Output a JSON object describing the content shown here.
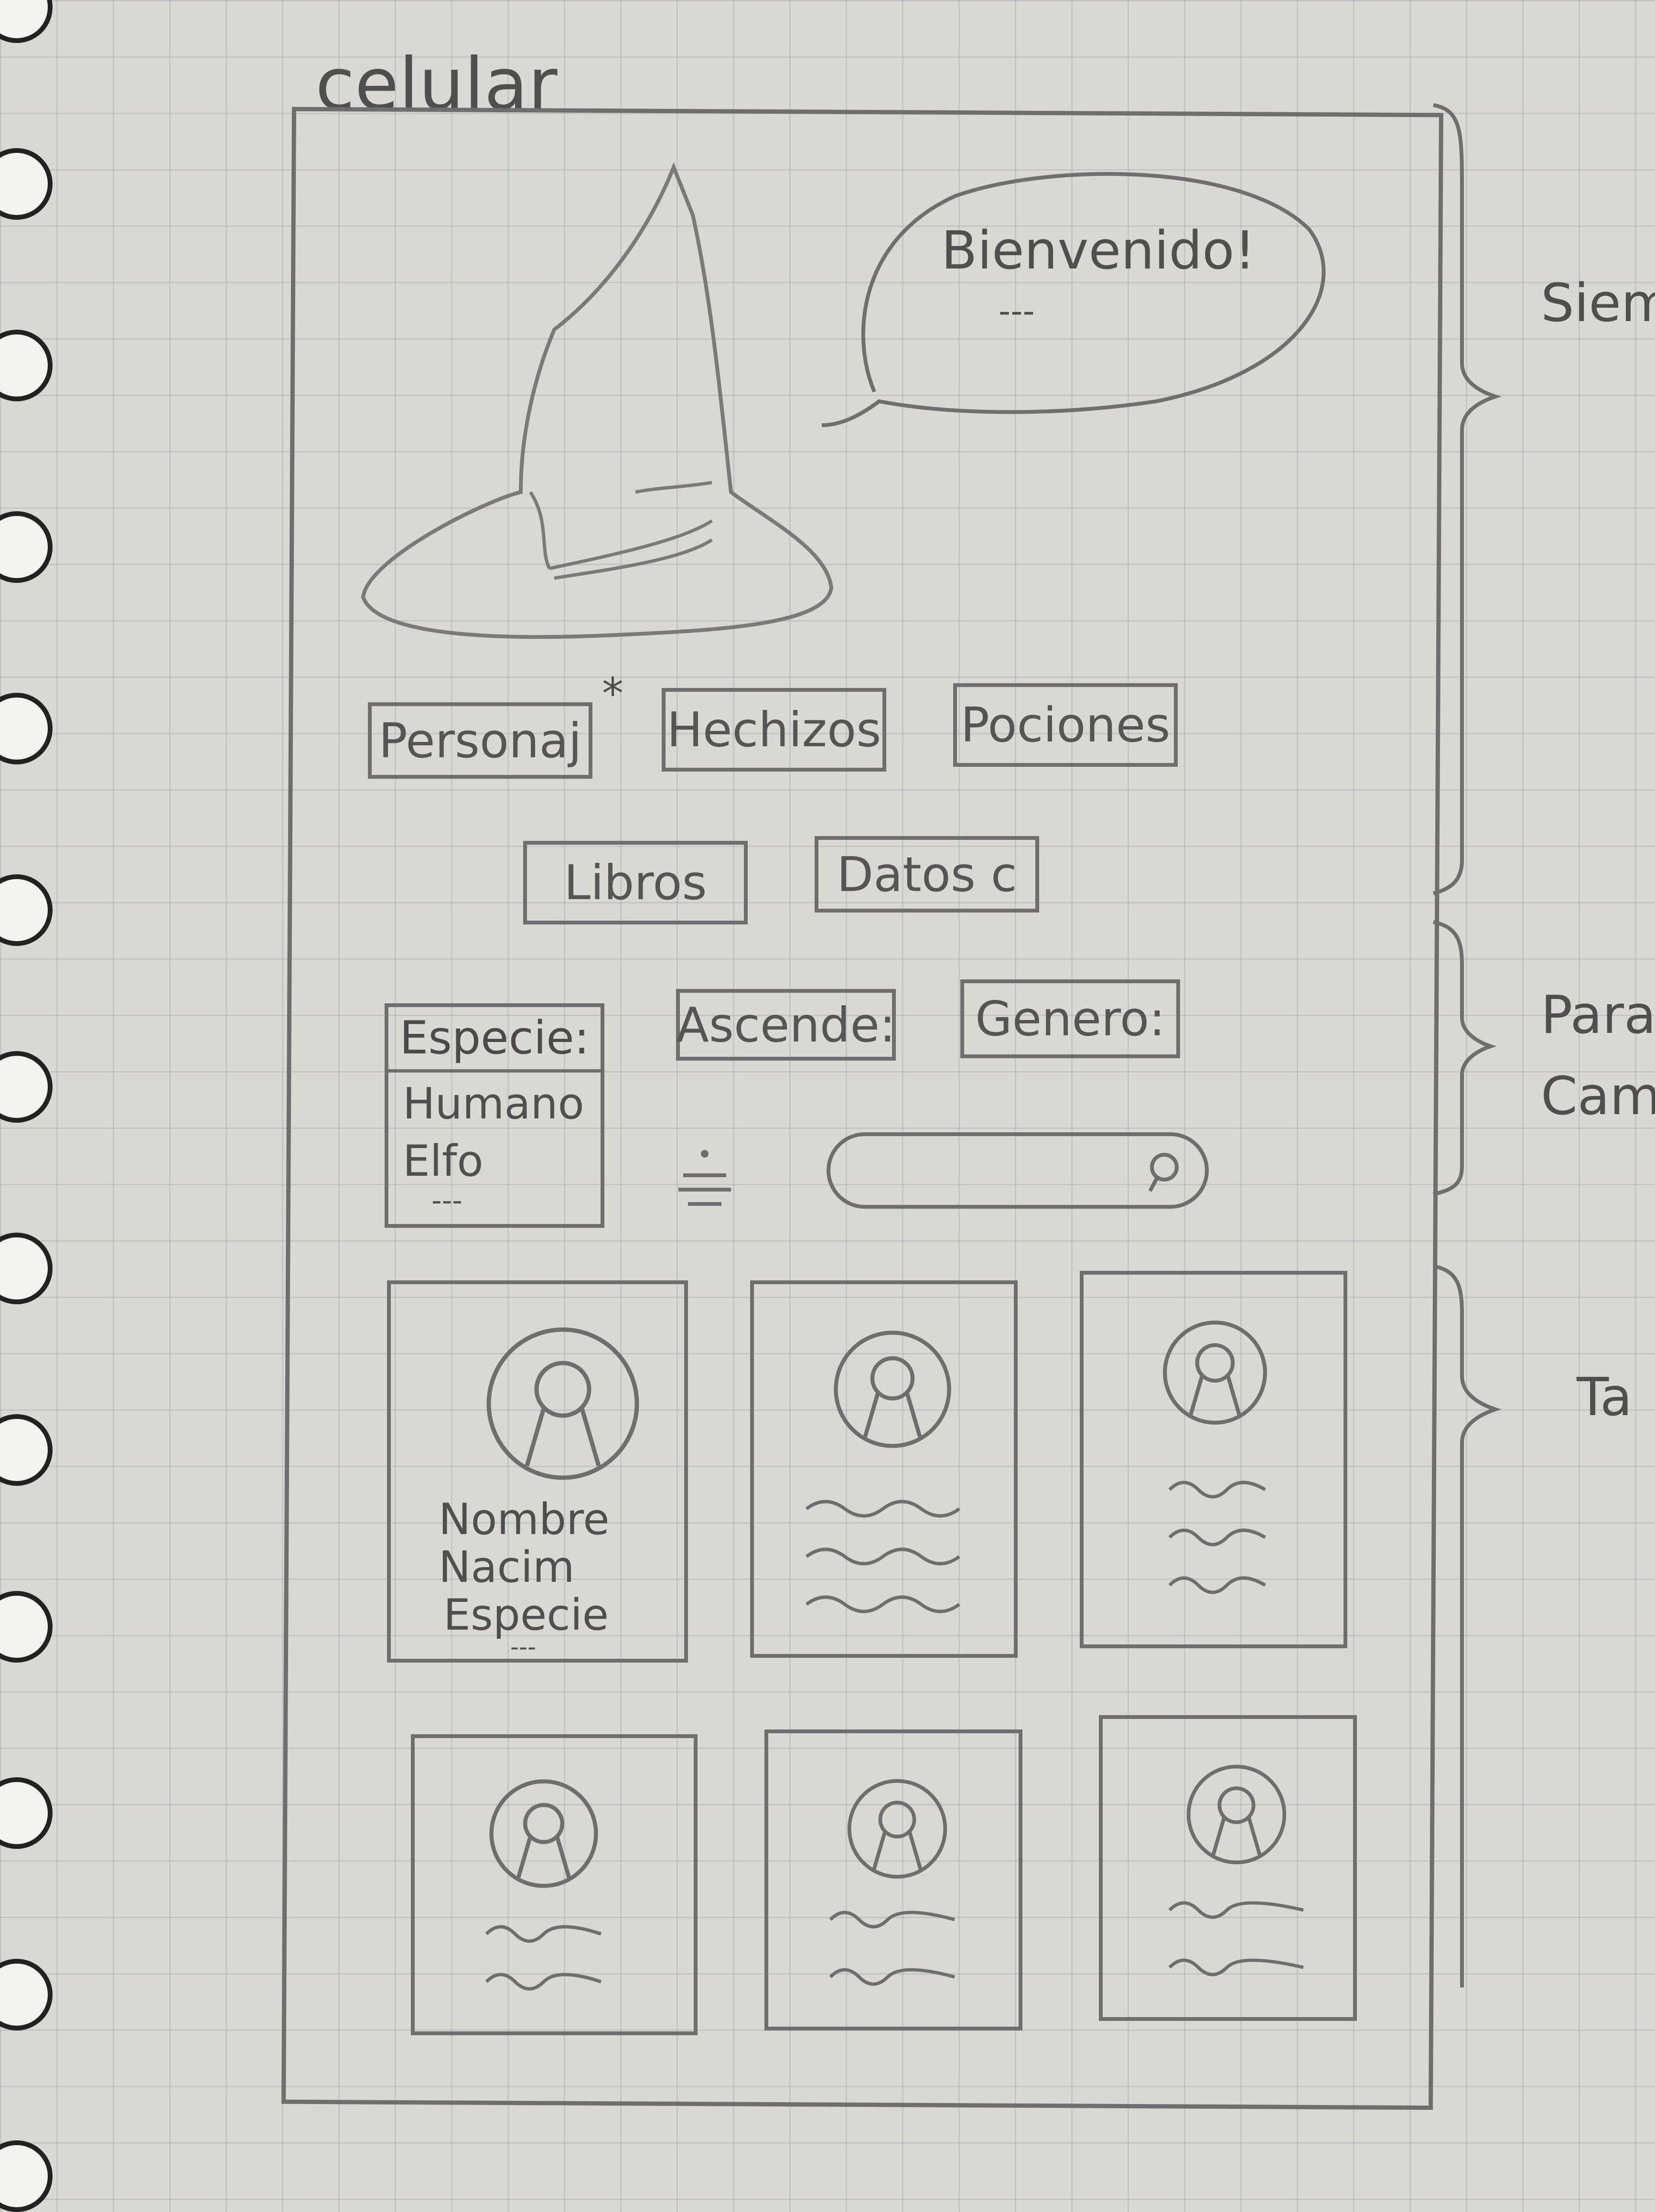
{
  "notebook": {
    "title": "celular",
    "side_labels": [
      "Siem",
      "Para",
      "Camb",
      "Ta"
    ]
  },
  "header": {
    "speech_bubble": "Bienvenido!",
    "speech_bubble_more": "---",
    "mascot_icon": "sorting-hat-icon"
  },
  "nav": {
    "buttons": [
      "Personaj",
      "Hechizos",
      "Pociones",
      "Libros",
      "Datos c"
    ],
    "selected_marker": "*"
  },
  "filters": {
    "especie_label": "Especie:",
    "especie_options": [
      "Humano",
      "Elfo",
      "---"
    ],
    "ascendencia_label": "Ascende:",
    "genero_label": "Genero:",
    "sort_icon": "sort-icon",
    "search_icon": "search-icon"
  },
  "cards": {
    "first_card_fields": [
      "Nombre",
      "Nacim",
      "Especie",
      "---"
    ],
    "avatar_icon": "user-avatar-icon"
  }
}
